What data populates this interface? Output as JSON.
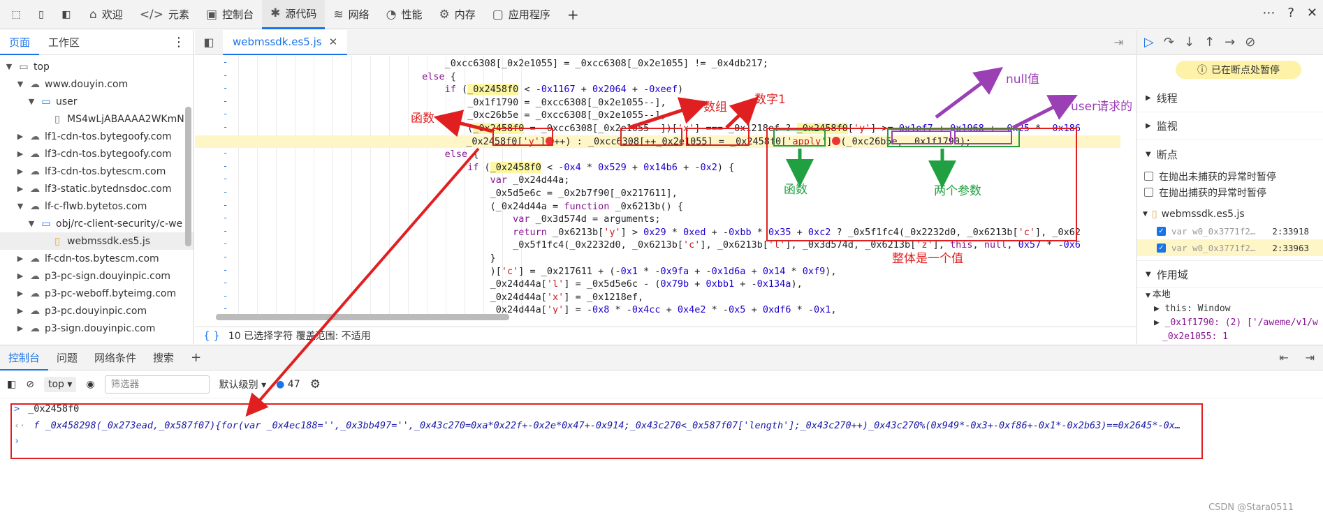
{
  "topbar": {
    "tabs": [
      {
        "label": "欢迎",
        "icon": "home-icon",
        "glyph": "⌂"
      },
      {
        "label": "元素",
        "icon": "code-icon",
        "glyph": "</>"
      },
      {
        "label": "控制台",
        "icon": "terminal-icon",
        "glyph": "▣"
      },
      {
        "label": "源代码",
        "icon": "bug-icon",
        "glyph": "✱"
      },
      {
        "label": "网络",
        "icon": "wifi-icon",
        "glyph": "≋"
      },
      {
        "label": "性能",
        "icon": "gauge-icon",
        "glyph": "◔"
      },
      {
        "label": "内存",
        "icon": "memory-icon",
        "glyph": "⚙"
      },
      {
        "label": "应用程序",
        "icon": "app-icon",
        "glyph": "▢"
      }
    ],
    "active_tab": "源代码"
  },
  "navigator": {
    "tabs": [
      "页面",
      "工作区"
    ],
    "tree": [
      {
        "label": "top",
        "depth": 0,
        "expanded": true,
        "icon": "frame-icon",
        "glyph": "▭"
      },
      {
        "label": "www.douyin.com",
        "depth": 1,
        "expanded": true,
        "icon": "cloud-icon",
        "glyph": "☁"
      },
      {
        "label": "user",
        "depth": 2,
        "expanded": true,
        "icon": "folder-icon",
        "glyph": "▭"
      },
      {
        "label": "MS4wLjABAAAA2WKmN",
        "depth": 3,
        "expanded": null,
        "icon": "file-icon",
        "glyph": "▯"
      },
      {
        "label": "lf1-cdn-tos.bytegoofy.com",
        "depth": 1,
        "expanded": false,
        "icon": "cloud-icon",
        "glyph": "☁"
      },
      {
        "label": "lf3-cdn-tos.bytegoofy.com",
        "depth": 1,
        "expanded": false,
        "icon": "cloud-icon",
        "glyph": "☁"
      },
      {
        "label": "lf3-cdn-tos.bytescm.com",
        "depth": 1,
        "expanded": false,
        "icon": "cloud-icon",
        "glyph": "☁"
      },
      {
        "label": "lf3-static.bytednsdoc.com",
        "depth": 1,
        "expanded": false,
        "icon": "cloud-icon",
        "glyph": "☁"
      },
      {
        "label": "lf-c-flwb.bytetos.com",
        "depth": 1,
        "expanded": true,
        "icon": "cloud-icon",
        "glyph": "☁"
      },
      {
        "label": "obj/rc-client-security/c-we",
        "depth": 2,
        "expanded": true,
        "icon": "folder-icon",
        "glyph": "▭"
      },
      {
        "label": "webmssdk.es5.js",
        "depth": 3,
        "expanded": null,
        "icon": "js-file-icon",
        "glyph": "▯"
      },
      {
        "label": "lf-cdn-tos.bytescm.com",
        "depth": 1,
        "expanded": false,
        "icon": "cloud-icon",
        "glyph": "☁"
      },
      {
        "label": "p3-pc-sign.douyinpic.com",
        "depth": 1,
        "expanded": false,
        "icon": "cloud-icon",
        "glyph": "☁"
      },
      {
        "label": "p3-pc-weboff.byteimg.com",
        "depth": 1,
        "expanded": false,
        "icon": "cloud-icon",
        "glyph": "☁"
      },
      {
        "label": "p3-pc.douyinpic.com",
        "depth": 1,
        "expanded": false,
        "icon": "cloud-icon",
        "glyph": "☁"
      },
      {
        "label": "p3-sign.douyinpic.com",
        "depth": 1,
        "expanded": false,
        "icon": "cloud-icon",
        "glyph": "☁"
      }
    ]
  },
  "editor": {
    "file_tab": "webmssdk.es5.js",
    "status_text": "10 已选择字符   覆盖范围: 不适用",
    "lines": [
      {
        "html": "                                            _0xcc6308[_0x2e1055] = _0xcc6308[_0x2e1055] != _0x4db217;"
      },
      {
        "html": "                                        <k>else</k> {"
      },
      {
        "html": "                                            <k>if</k> (<v>_0x2458f0</v> &lt; -<n>0x1167</n> + <n>0x2064</n> + -<n>0xeef</n>)"
      },
      {
        "html": "                                                _0x1f1790 = _0xcc6308[_0x2e1055--],"
      },
      {
        "html": "                                                _0xc26b5e = _0xcc6308[_0x2e1055--],"
      },
      {
        "html": "                                                (<v>_0x2458f0</v> = _0xcc6308[_0x2e1055--])[<s>'x'</s>] === _0x1218ef ? <v>_0x2458f0</v>[<s>'y'</s>] &gt;= <n>0x1ef7</n> + <n>0x1968</n> + -<n>0x25</n> * -<n>0x186</n>"
      },
      {
        "html": "                                                 _0x2458f0[<s>'y'</s>]<b></b>++) : _0xcc6308[++_0x2e1055] = _0x2458f0[<s>'apply'</s>]<b></b>(_0xc26b5e, _0x1f1790);",
        "hl": true
      },
      {
        "html": "                                            <k>else</k> {"
      },
      {
        "html": "                                                <k>if</k> (<v>_0x2458f0</v> &lt; -<n>0x4</n> * <n>0x529</n> + <n>0x14b6</n> + -<n>0x2</n>) {"
      },
      {
        "html": "                                                    <k>var</k> _0x24d44a;"
      },
      {
        "html": "                                                    _0x5d5e6c = _0x2b7f90[_0x217611],"
      },
      {
        "html": "                                                    (_0x24d44a = <k>function</k> _0x6213b() {"
      },
      {
        "html": "                                                        <k>var</k> _0x3d574d = arguments;"
      },
      {
        "html": "                                                        <k>return</k> _0x6213b[<s>'y'</s>] &gt; <n>0x29</n> * <n>0xed</n> + -<n>0xbb</n> * <n>0x35</n> + <n>0xc2</n> ? _0x5f1fc4(_0x2232d0, _0x6213b[<s>'c'</s>], _0x62"
      },
      {
        "html": "                                                        _0x5f1fc4(_0x2232d0, _0x6213b[<s>'c'</s>], _0x6213b[<s>'l'</s>], _0x3d574d, _0x6213b[<s>'z'</s>], <k>this</k>, <k>null</k>, <n>0x57</n> * -<n>0x6</n>"
      },
      {
        "html": "                                                    }"
      },
      {
        "html": "                                                    )[<s>'c'</s>] = _0x217611 + (-<n>0x1</n> * -<n>0x9fa</n> + -<n>0x1d6a</n> + <n>0x14</n> * <n>0xf9</n>),"
      },
      {
        "html": "                                                    _0x24d44a[<s>'l'</s>] = _0x5d5e6c - (<n>0x79b</n> + <n>0xbb1</n> + -<n>0x134a</n>),"
      },
      {
        "html": "                                                    _0x24d44a[<s>'x'</s>] = _0x1218ef,"
      },
      {
        "html": "                                                    _0x24d44a[<s>'y'</s>] = -<n>0x8</n> * -<n>0x4cc</n> + <n>0x4e2</n> * -<n>0x5</n> + <n>0xdf6</n> * -<n>0x1</n>,"
      }
    ]
  },
  "annotations": {
    "hanshu_left": "函数",
    "shuzu": "数组",
    "shuzi1": "数字1",
    "nullzhi": "null值",
    "user_req": "user请求的",
    "hanshu_green": "函数",
    "liangge": "两个参数",
    "zhengti": "整体是一个值"
  },
  "debugger": {
    "paused_label": "已在断点处暂停",
    "sections": [
      "线程",
      "监视",
      "断点"
    ],
    "pause_options": [
      "在抛出未捕获的异常时暂停",
      "在抛出捕获的异常时暂停"
    ],
    "bp_file": "webmssdk.es5.js",
    "bp_rows": [
      {
        "text": "var w0_0x3771f2…",
        "loc": "2:33918"
      },
      {
        "text": "var w0_0x3771f2…",
        "loc": "2:33963"
      }
    ],
    "scope_header": "作用域",
    "scope_local": "本地",
    "scope_items": [
      "this: Window",
      "_0x1f1790: (2) ['/aweme/v1/w",
      "_0x2e1055: 1"
    ]
  },
  "console": {
    "tabs": [
      "控制台",
      "问题",
      "网络条件",
      "搜索"
    ],
    "context": "top",
    "filter_placeholder": "筛选器",
    "level": "默认级别",
    "issue_count": "47",
    "input_expr": "_0x2458f0",
    "output": "f _0x458298(_0x273ead,_0x587f07){for(var _0x4ec188='',_0x3bb497='',_0x43c270=0xa*0x22f+-0x2e*0x47+-0x914;_0x43c270<_0x587f07['length'];_0x43c270++)_0x43c270%(0x949*-0x3+-0xf86+-0x1*-0x2b63)==0x2645*-0x…"
  },
  "watermark": "CSDN @Stara0511",
  "colors": {
    "accent": "#1a73e8",
    "annot_red": "#e02020",
    "annot_green": "#20a040",
    "annot_purple": "#9b3fb5",
    "highlight": "#fff6c7"
  }
}
